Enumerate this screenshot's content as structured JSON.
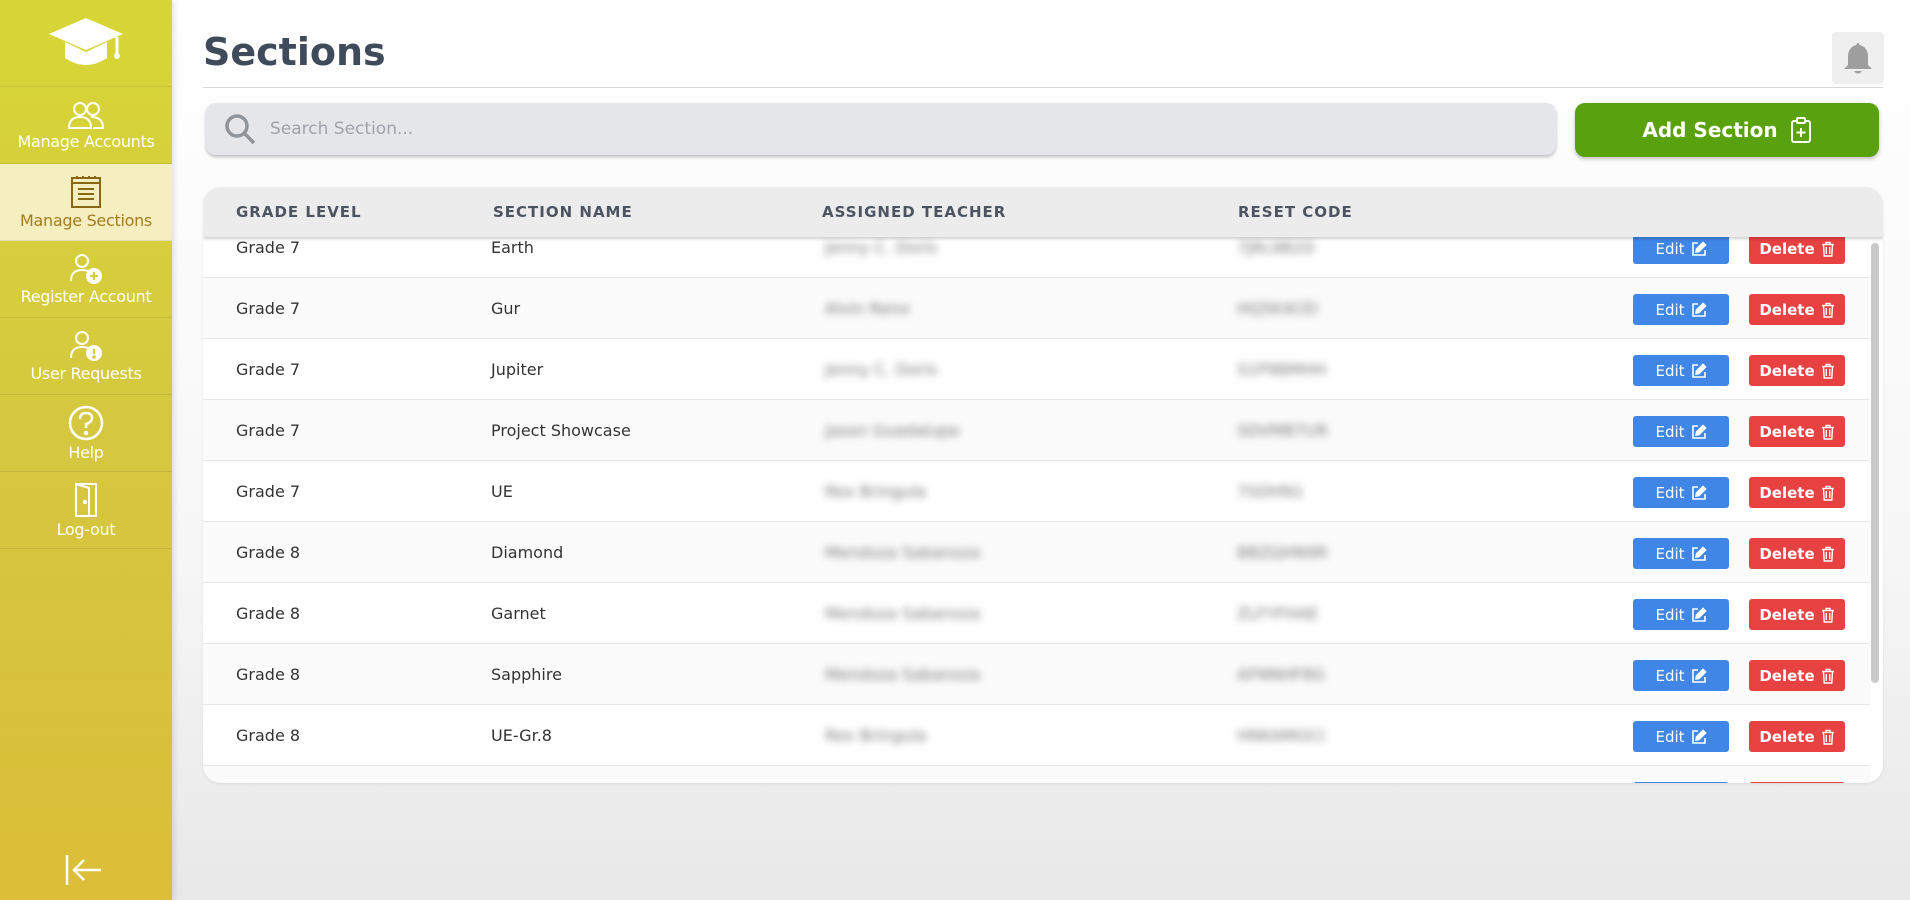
{
  "sidebar": {
    "items": [
      {
        "label": "Manage Accounts",
        "icon": "users-icon"
      },
      {
        "label": "Manage Sections",
        "icon": "clipboard-list-icon"
      },
      {
        "label": "Register Account",
        "icon": "user-plus-icon"
      },
      {
        "label": "User Requests",
        "icon": "user-alert-icon"
      },
      {
        "label": "Help",
        "icon": "question-circle-icon"
      },
      {
        "label": "Log-out",
        "icon": "door-icon"
      }
    ],
    "active_index": 1
  },
  "header": {
    "title": "Sections"
  },
  "search": {
    "placeholder": "Search Section..."
  },
  "toolbar": {
    "add_label": "Add Section"
  },
  "table": {
    "headers": [
      "GRADE LEVEL",
      "SECTION NAME",
      "ASSIGNED TEACHER",
      "RESET CODE"
    ],
    "rows": [
      {
        "grade": "Grade 7",
        "section": "Earth",
        "teacher": "Jenny C. Doris",
        "code": "7J8L9B2D"
      },
      {
        "grade": "Grade 7",
        "section": "Gur",
        "teacher": "Alvin Reno",
        "code": "HQ5K4CEI"
      },
      {
        "grade": "Grade 7",
        "section": "Jupiter",
        "teacher": "Jenny C. Doris",
        "code": "S1P9BMHH"
      },
      {
        "grade": "Grade 7",
        "section": "Project Showcase",
        "teacher": "Jason Guadalupe",
        "code": "SDVMB7UR"
      },
      {
        "grade": "Grade 7",
        "section": "UE",
        "teacher": "Rex Bringula",
        "code": "7SDHN1"
      },
      {
        "grade": "Grade 8",
        "section": "Diamond",
        "teacher": "Mendoza Sabanoza",
        "code": "BBZQHN9R"
      },
      {
        "grade": "Grade 8",
        "section": "Garnet",
        "teacher": "Mendoza Sabanoza",
        "code": "ZLFYFHAE"
      },
      {
        "grade": "Grade 8",
        "section": "Sapphire",
        "teacher": "Mendoza Sabanoza",
        "code": "AFNNHF8G"
      },
      {
        "grade": "Grade 8",
        "section": "UE-Gr.8",
        "teacher": "Rex Bringula",
        "code": "HNKAMGCI"
      }
    ],
    "edit_label": "Edit",
    "delete_label": "Delete"
  },
  "colors": {
    "sidebar": "#d7d636",
    "active_nav": "#f4eec0",
    "add_button": "#5aa10e",
    "edit_button": "#3f86e6",
    "delete_button": "#e84141"
  }
}
